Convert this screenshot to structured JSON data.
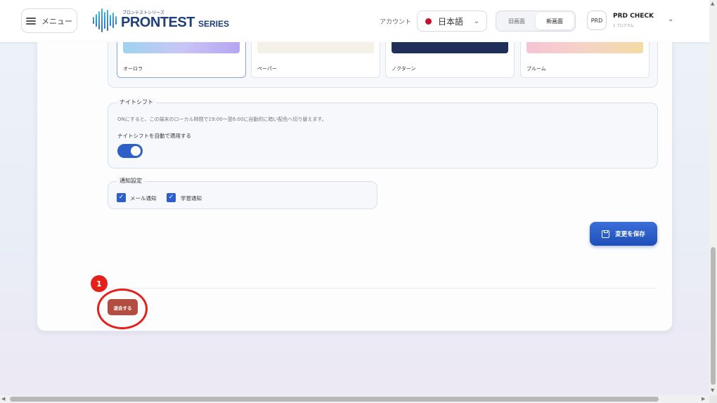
{
  "header": {
    "menu_label": "メニュー",
    "logo_sub": "プロンテストシリーズ",
    "logo_main": "PRONTEST",
    "logo_series": "SERIES",
    "account_label": "アカウント",
    "language": "日本語",
    "view_old": "旧画面",
    "view_new": "新画面",
    "user_badge": "PRD",
    "user_name": "PRD CHECK",
    "user_sub": "2 プログラム"
  },
  "themes": [
    {
      "label": "オーロラ",
      "selected": true
    },
    {
      "label": "ペーパー",
      "selected": false
    },
    {
      "label": "ノクターン",
      "selected": false
    },
    {
      "label": "ブルーム",
      "selected": false
    }
  ],
  "night_shift": {
    "legend": "ナイトシフト",
    "description": "ONにすると、この端末のローカル時間で19:00〜翌6:00に自動的に暗い配色へ切り替えます。",
    "toggle_label": "ナイトシフトを自動で適用する",
    "enabled": true
  },
  "notifications": {
    "legend": "通知設定",
    "email_label": "メール通知",
    "email_checked": true,
    "learning_label": "学習通知",
    "learning_checked": true
  },
  "save_button_label": "変更を保存",
  "withdraw_button_label": "退会する",
  "annotation": {
    "step_number": "1",
    "color": "#e3211a"
  },
  "colors": {
    "accent": "#2d5fc9",
    "danger": "#b34d42",
    "brand": "#1e3f78"
  }
}
